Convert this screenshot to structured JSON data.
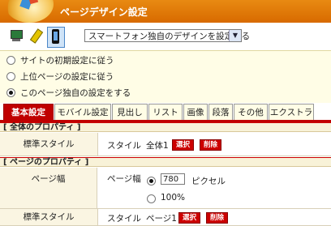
{
  "title": "ページデザイン設定",
  "device_select": {
    "value": "スマートフォン独自のデザインを設定する"
  },
  "inherit_options": [
    {
      "label": "サイトの初期設定に従う",
      "selected": false
    },
    {
      "label": "上位ページの設定に従う",
      "selected": false
    },
    {
      "label": "このページ独自の設定をする",
      "selected": true
    }
  ],
  "tabs": [
    "基本設定",
    "モバイル設定",
    "見出し",
    "リスト",
    "画像",
    "段落",
    "その他",
    "エクストラ"
  ],
  "active_tab": "基本設定",
  "sections": {
    "all": {
      "header": "[ 全体のプロパティ ]",
      "style_label": "標準スタイル",
      "style_prefix": "スタイル",
      "style_value": "全体1",
      "select_btn": "選択",
      "delete_btn": "削除"
    },
    "page": {
      "header": "[ ページのプロパティ ]",
      "width_label": "ページ幅",
      "width_inner_label": "ページ幅",
      "width_value": "780",
      "width_unit": "ピクセル",
      "width_alt": "100%",
      "style_label": "標準スタイル",
      "style_prefix": "スタイル",
      "style_value": "ページ1",
      "select_btn": "選択",
      "delete_btn": "削除"
    }
  },
  "colors": {
    "title_bar": "#e07a08",
    "accent_red": "#c00000",
    "panel_cream": "#fffde6"
  }
}
